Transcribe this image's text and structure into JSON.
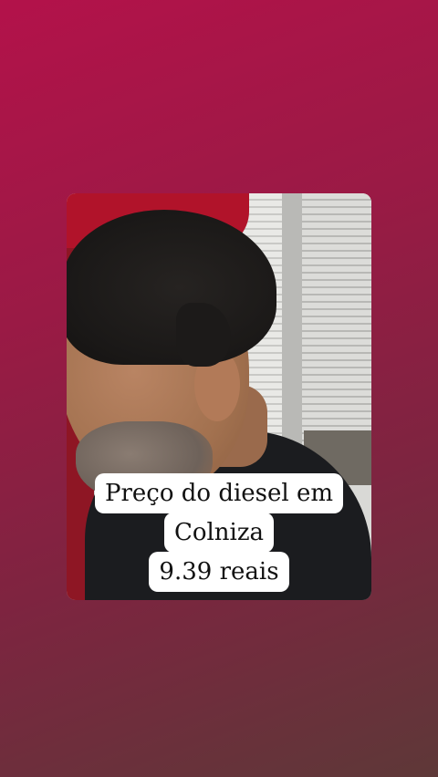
{
  "caption": {
    "line1": "Preço do diesel em",
    "line2": "Colniza",
    "line3": "9.39 reais"
  },
  "colors": {
    "background_top": "#b3124a",
    "background_bottom": "#5e3838",
    "caption_background": "#ffffff",
    "caption_text": "#111111"
  }
}
